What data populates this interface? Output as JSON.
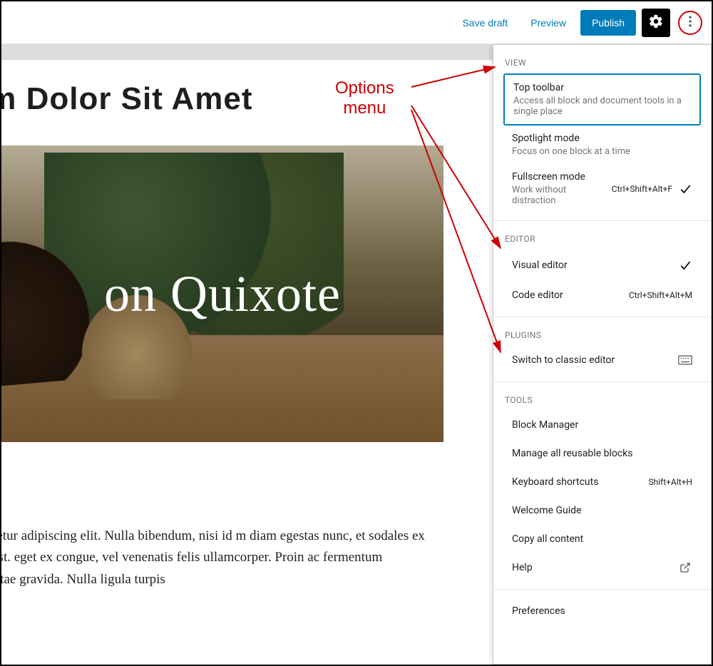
{
  "header": {
    "save_draft": "Save draft",
    "preview": "Preview",
    "publish": "Publish"
  },
  "post": {
    "title_fragment": "psum Dolor Sit Amet",
    "hero_text": "on Quixote",
    "heading_fragment": "m",
    "body_text": "t amet, consectetur adipiscing elit. Nulla bibendum, nisi id m diam egestas nunc, et sodales ex nulla sit amet est. eget ex congue, vel venenatis felis ullamcorper. Proin ac fermentum fringilla felis vitae gravida. Nulla ligula turpis"
  },
  "annotation": {
    "label_line1": "Options",
    "label_line2": "menu"
  },
  "menu": {
    "view": {
      "label": "VIEW",
      "top_toolbar": {
        "title": "Top toolbar",
        "desc": "Access all block and document tools in a single place"
      },
      "spotlight": {
        "title": "Spotlight mode",
        "desc": "Focus on one block at a time"
      },
      "fullscreen": {
        "title": "Fullscreen mode",
        "desc": "Work without distraction",
        "shortcut": "Ctrl+Shift+Alt+F",
        "checked": true
      }
    },
    "editor": {
      "label": "EDITOR",
      "visual": {
        "title": "Visual editor",
        "checked": true
      },
      "code": {
        "title": "Code editor",
        "shortcut": "Ctrl+Shift+Alt+M"
      }
    },
    "plugins": {
      "label": "PLUGINS",
      "classic": {
        "title": "Switch to classic editor"
      }
    },
    "tools": {
      "label": "TOOLS",
      "items": {
        "block_manager": "Block Manager",
        "reusable": "Manage all reusable blocks",
        "shortcuts": "Keyboard shortcuts",
        "shortcuts_hint": "Shift+Alt+H",
        "welcome": "Welcome Guide",
        "copy": "Copy all content",
        "help": "Help"
      }
    },
    "preferences": "Preferences"
  }
}
